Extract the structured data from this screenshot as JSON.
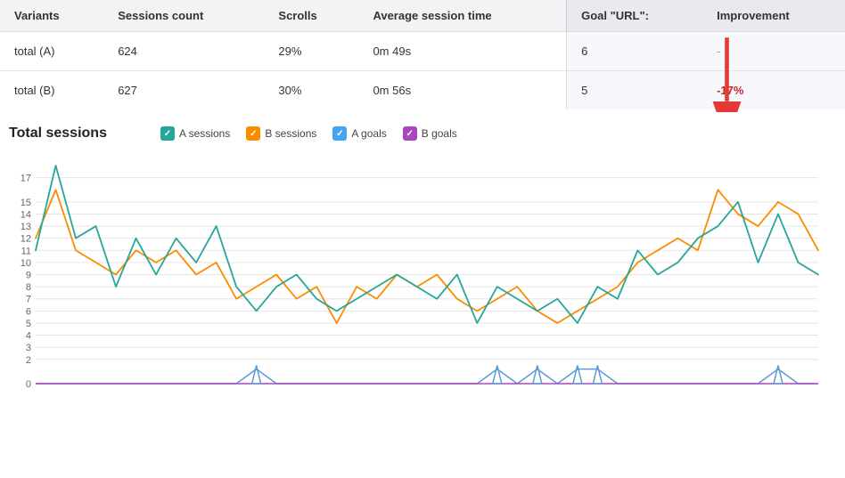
{
  "table": {
    "headers": [
      "Variants",
      "Sessions count",
      "Scrolls",
      "Average session time",
      "Goal \"URL\":",
      "Improvement"
    ],
    "rows": [
      {
        "variant": "total (A)",
        "sessions": "624",
        "scrolls": "29%",
        "avg_session": "0m 49s",
        "goal": "6",
        "improvement": "-",
        "improvement_type": "dash"
      },
      {
        "variant": "total (B)",
        "sessions": "627",
        "scrolls": "30%",
        "avg_session": "0m 56s",
        "goal": "5",
        "improvement": "-17%",
        "improvement_type": "negative"
      }
    ]
  },
  "chart": {
    "title": "Total sessions",
    "legend": [
      {
        "label": "A sessions",
        "color": "#26a69a",
        "shape": "check"
      },
      {
        "label": "B sessions",
        "color": "#fb8c00",
        "shape": "check"
      },
      {
        "label": "A goals",
        "color": "#42a5f5",
        "shape": "check"
      },
      {
        "label": "B goals",
        "color": "#ab47bc",
        "shape": "check"
      }
    ],
    "y_labels": [
      "0",
      "2",
      "3",
      "4",
      "5",
      "6",
      "7",
      "8",
      "9",
      "10",
      "11",
      "12",
      "13",
      "14",
      "15",
      "17"
    ],
    "a_sessions": [
      11,
      18,
      12,
      13,
      8,
      12,
      9,
      12,
      10,
      13,
      8,
      6,
      8,
      9,
      7,
      6,
      7,
      8,
      9,
      8,
      7,
      9,
      5,
      8,
      7,
      6,
      7,
      5,
      8,
      7,
      11,
      9,
      10,
      12,
      13,
      15,
      10,
      14,
      10,
      9
    ],
    "b_sessions": [
      12,
      16,
      11,
      10,
      9,
      11,
      10,
      11,
      9,
      10,
      7,
      8,
      9,
      7,
      8,
      5,
      8,
      7,
      9,
      8,
      9,
      7,
      6,
      7,
      8,
      6,
      5,
      6,
      7,
      8,
      10,
      11,
      12,
      11,
      16,
      14,
      13,
      15,
      14,
      11
    ],
    "a_goals": [
      0,
      0,
      0,
      0,
      0,
      0,
      0,
      0,
      0,
      0,
      0,
      1,
      0,
      0,
      0,
      0,
      0,
      0,
      0,
      0,
      0,
      0,
      0,
      1,
      0,
      1,
      0,
      1,
      1,
      0,
      0,
      0,
      0,
      0,
      0,
      0,
      0,
      1,
      0,
      0
    ],
    "b_goals": [
      0,
      0,
      0,
      0,
      0,
      0,
      0,
      0,
      0,
      0,
      0,
      0,
      0,
      0,
      0,
      0,
      0,
      0,
      0,
      0,
      0,
      0,
      0,
      0,
      0,
      0,
      0,
      0,
      0,
      0,
      0,
      0,
      0,
      0,
      0,
      0,
      0,
      0,
      0,
      0
    ]
  },
  "arrow": {
    "label": "points to -17%"
  }
}
